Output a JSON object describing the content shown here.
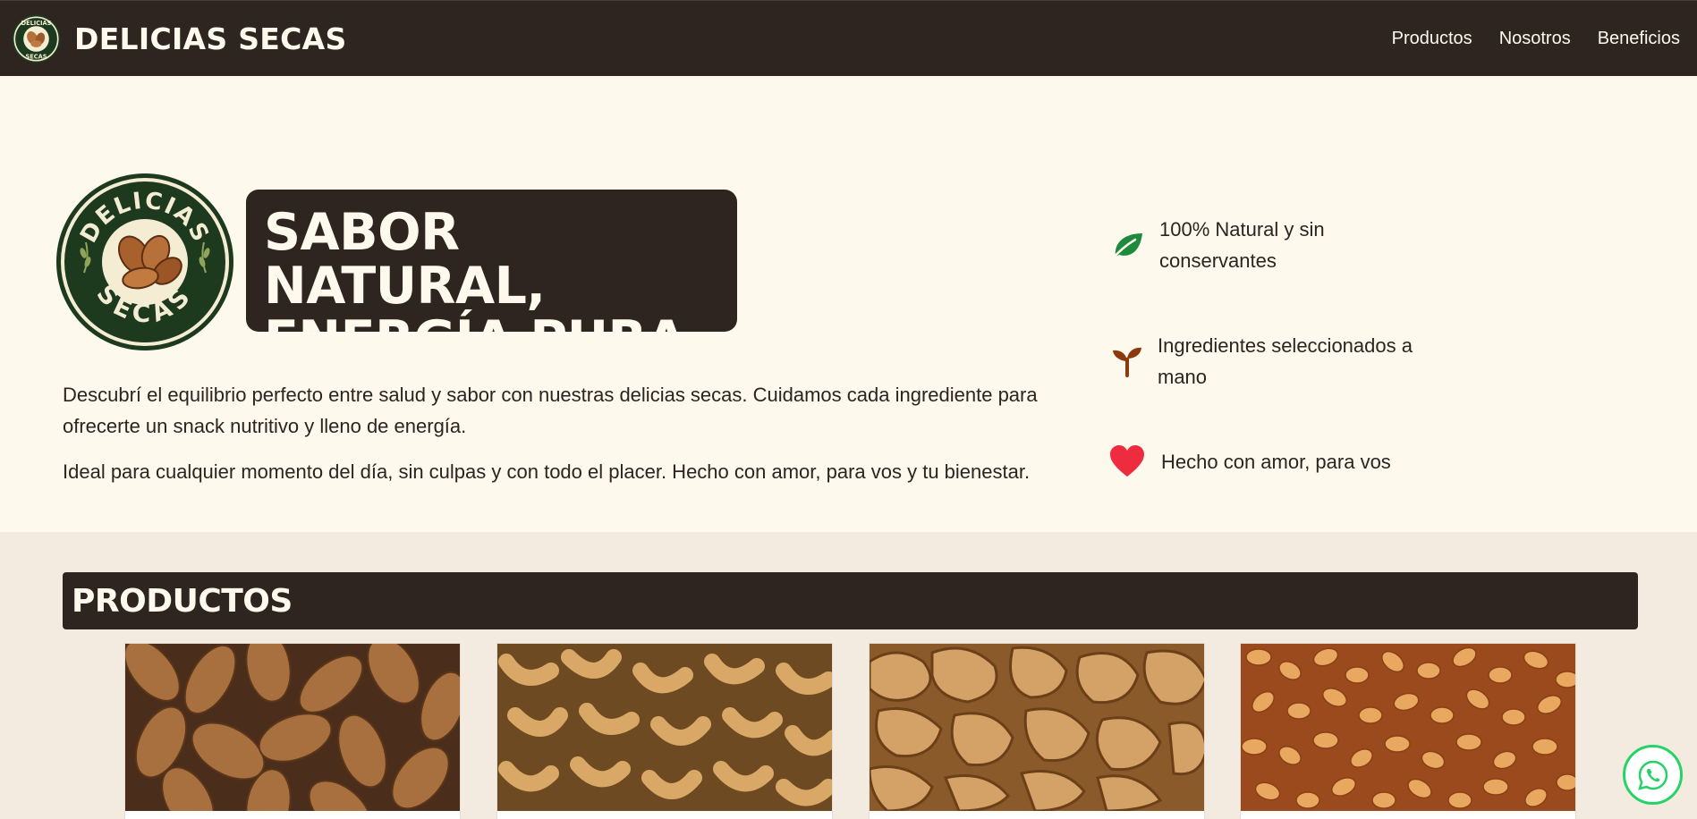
{
  "nav": {
    "brand": "DELICIAS SECAS",
    "logo_top": "DELICIAS",
    "logo_bottom": "SECAS",
    "links": [
      "Productos",
      "Nosotros",
      "Beneficios"
    ]
  },
  "hero": {
    "title_line1": "SABOR NATURAL,",
    "title_line2": "ENERGÍA PURA",
    "paragraph1": "Descubrí el equilibrio perfecto entre salud y sabor con nuestras delicias secas. Cuidamos cada ingrediente para ofrecerte un snack nutritivo y lleno de energía.",
    "paragraph2": "Ideal para cualquier momento del día, sin culpas y con todo el placer. Hecho con amor, para vos y tu bienestar.",
    "features": [
      {
        "icon": "leaf-icon",
        "text": "100% Natural y sin conservantes",
        "color": "#1e8a3c"
      },
      {
        "icon": "sprout-icon",
        "text": "Ingredientes seleccionados a mano",
        "color": "#8b3a0f"
      },
      {
        "icon": "heart-icon",
        "text": "Hecho con amor, para vos",
        "color": "#ef2b3f"
      }
    ]
  },
  "products": {
    "title": "PRODUCTOS",
    "items": [
      {
        "name": "almonds-image"
      },
      {
        "name": "cashews-image"
      },
      {
        "name": "walnuts-image"
      },
      {
        "name": "peanuts-image"
      }
    ]
  },
  "colors": {
    "dark_brown": "#2e2420",
    "cream": "#fdf9ec",
    "beige": "#f3ebe0",
    "logo_green": "#1d3a1f",
    "whatsapp_green": "#25d366"
  },
  "floating": {
    "icon": "whatsapp-icon"
  }
}
